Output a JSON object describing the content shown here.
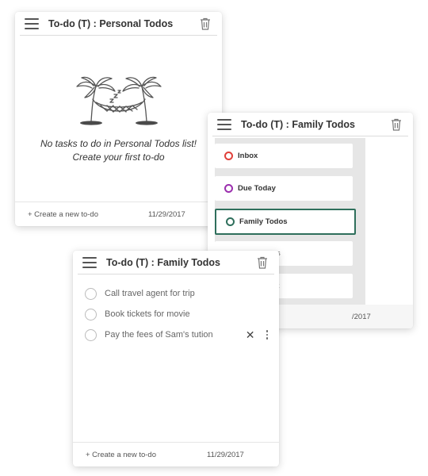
{
  "cards": {
    "personal": {
      "title": "To-do (T) : Personal Todos",
      "empty_line1": "No tasks to do in Personal Todos list!",
      "empty_line2": "Create your first to-do",
      "footer_left": "+ Create a new to-do",
      "footer_date": "11/29/2017"
    },
    "family_lists": {
      "title": "To-do (T) : Family Todos",
      "lists": [
        {
          "label": "Inbox",
          "color": "#e0403a"
        },
        {
          "label": "Due Today",
          "color": "#9b2fae"
        },
        {
          "label": "Family Todos",
          "color": "#2f6f5c",
          "selected": true
        },
        {
          "label": "s"
        },
        {
          "label": "st"
        }
      ],
      "footer_date": "/2017"
    },
    "family_tasks": {
      "title": "To-do (T) : Family Todos",
      "tasks": [
        {
          "label": "Call travel agent for trip"
        },
        {
          "label": "Book tickets for movie"
        },
        {
          "label": "Pay the fees of Sam's tution"
        }
      ],
      "close_glyph": "✕",
      "footer_left": "+ Create a new to-do",
      "footer_date": "11/29/2017"
    }
  },
  "colors": {
    "accent": "#2f6f5c",
    "inbox": "#e0403a",
    "due_today": "#9b2fae"
  },
  "icons": [
    "menu-icon",
    "trash-icon",
    "hammock-illustration",
    "close-icon",
    "more-vertical-icon"
  ]
}
